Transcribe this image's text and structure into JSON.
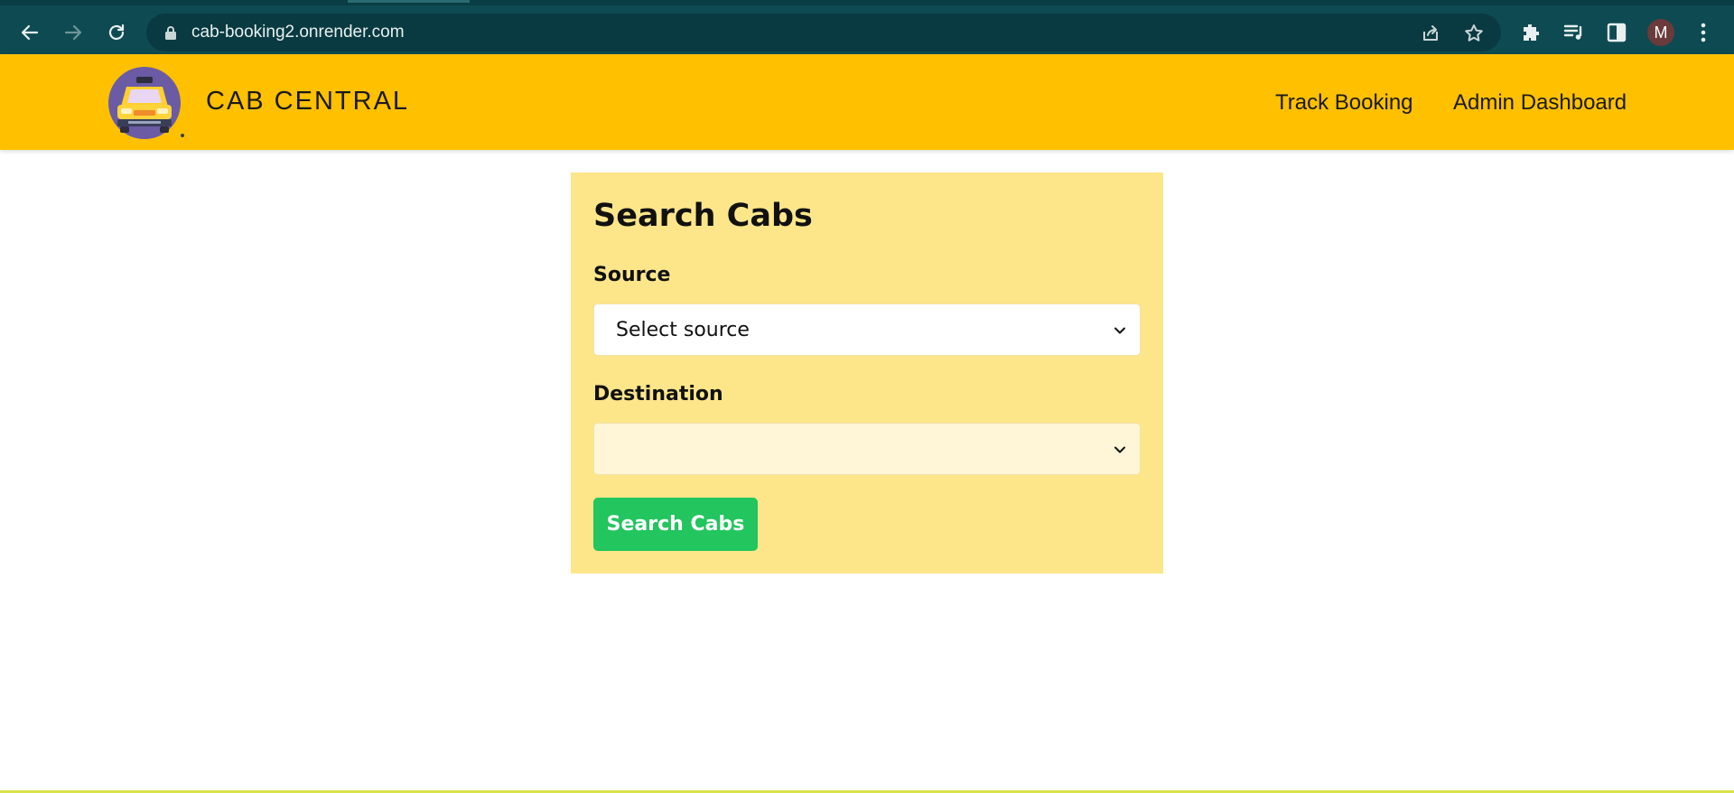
{
  "browser": {
    "url": "cab-booking2.onrender.com",
    "profile_initial": "M",
    "icons": [
      "back-icon",
      "forward-icon",
      "reload-icon",
      "lock-icon",
      "share-icon",
      "star-icon",
      "extensions-icon",
      "media-icon",
      "side-panel-icon",
      "menu-icon"
    ]
  },
  "header": {
    "brand": "CAB CENTRAL",
    "nav": [
      "Track Booking",
      "Admin Dashboard"
    ],
    "colors": {
      "background": "#ffc000"
    }
  },
  "search_form": {
    "title": "Search Cabs",
    "source": {
      "label": "Source",
      "value": "Select source"
    },
    "destination": {
      "label": "Destination",
      "value": ""
    },
    "submit_label": "Search Cabs",
    "colors": {
      "card": "#fde68a",
      "button": "#22c55e"
    }
  }
}
